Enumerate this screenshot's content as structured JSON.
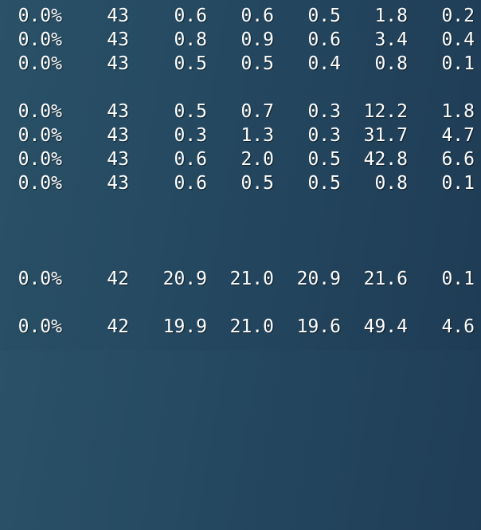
{
  "terminal": {
    "rows": [
      {
        "cells": [
          "0.0%",
          "43",
          "0.6",
          "0.6",
          "0.5",
          "1.8",
          "0.2"
        ]
      },
      {
        "cells": [
          "0.0%",
          "43",
          "0.8",
          "0.9",
          "0.6",
          "3.4",
          "0.4"
        ]
      },
      {
        "cells": [
          "0.0%",
          "43",
          "0.5",
          "0.5",
          "0.4",
          "0.8",
          "0.1"
        ]
      },
      {
        "cells": [
          "0.0%",
          "43",
          "0.5",
          "0.7",
          "0.3",
          "12.2",
          "1.8"
        ]
      },
      {
        "cells": [
          "0.0%",
          "43",
          "0.3",
          "1.3",
          "0.3",
          "31.7",
          "4.7"
        ]
      },
      {
        "cells": [
          "0.0%",
          "43",
          "0.6",
          "2.0",
          "0.5",
          "42.8",
          "6.6"
        ]
      },
      {
        "cells": [
          "0.0%",
          "43",
          "0.6",
          "0.5",
          "0.5",
          "0.8",
          "0.1"
        ]
      },
      {
        "cells": [
          "0.0%",
          "42",
          "20.9",
          "21.0",
          "20.9",
          "21.6",
          "0.1"
        ]
      },
      {
        "cells": [
          "0.0%",
          "42",
          "19.9",
          "21.0",
          "19.6",
          "49.4",
          "4.6"
        ]
      }
    ]
  }
}
